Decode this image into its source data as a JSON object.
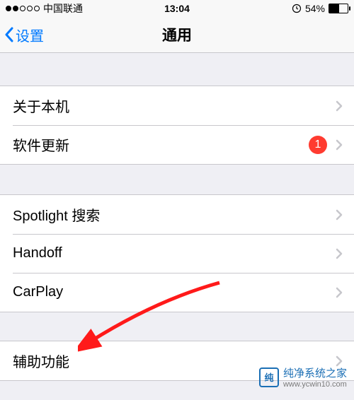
{
  "status": {
    "carrier": "中国联通",
    "time": "13:04",
    "battery_pct": "54%"
  },
  "nav": {
    "back_label": "设置",
    "title": "通用"
  },
  "group1": {
    "about": "关于本机",
    "software_update": "软件更新",
    "update_badge": "1"
  },
  "group2": {
    "spotlight": "Spotlight 搜索",
    "handoff": "Handoff",
    "carplay": "CarPlay"
  },
  "group3": {
    "accessibility": "辅助功能"
  },
  "watermark": {
    "name": "纯净系统之家",
    "url": "www.ycwin10.com",
    "logo": "纯"
  }
}
